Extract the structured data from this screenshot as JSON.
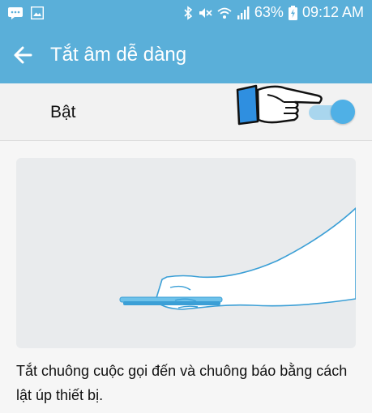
{
  "status_bar": {
    "battery": "63%",
    "time": "09:12 AM",
    "icons": [
      "message-icon",
      "image-icon",
      "bluetooth-icon",
      "mute-icon",
      "wifi-icon",
      "signal-icon",
      "battery-charging-icon"
    ]
  },
  "app_bar": {
    "title": "Tắt âm dễ dàng",
    "back_icon": "arrow-left-icon"
  },
  "toggle": {
    "label": "Bật",
    "state": "on"
  },
  "description": "Tắt chuông cuộc gọi đến và chuông báo bằng cách lật úp thiết bị.",
  "colors": {
    "accent": "#5aafd9",
    "switch_knob": "#4fb0e6",
    "switch_track": "#a9d6ee",
    "hand_cuff": "#2f8fe0"
  }
}
